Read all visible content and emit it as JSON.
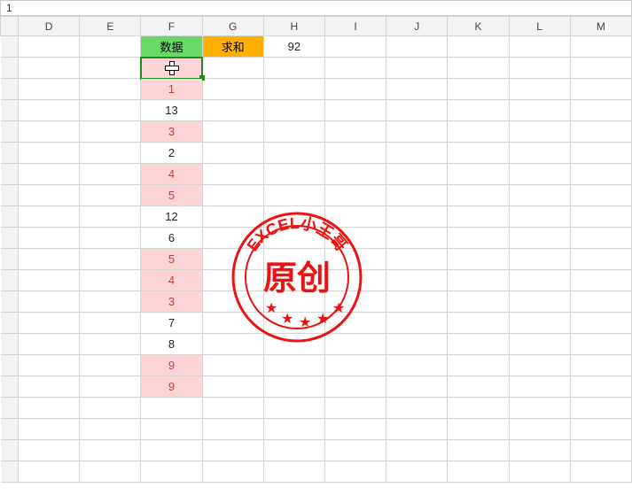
{
  "formula_bar": {
    "value": "1"
  },
  "columns": [
    "D",
    "E",
    "F",
    "G",
    "H",
    "I",
    "J",
    "K",
    "L",
    "M"
  ],
  "headers": {
    "F": {
      "label": "数据",
      "class": "hdr-f"
    },
    "G": {
      "label": "求和",
      "class": "hdr-g"
    },
    "H": {
      "label": "92",
      "class": "plain"
    }
  },
  "selected": {
    "col": "F",
    "row": 0
  },
  "chart_data": {
    "type": "table",
    "title": "数据",
    "sum_label": "求和",
    "sum_value": 92,
    "values": [
      1,
      1,
      13,
      3,
      2,
      4,
      5,
      12,
      6,
      5,
      4,
      3,
      7,
      8,
      9,
      9
    ],
    "highlighted": [
      true,
      true,
      false,
      true,
      false,
      true,
      true,
      false,
      false,
      true,
      true,
      true,
      false,
      false,
      true,
      true
    ]
  },
  "stamp": {
    "top_text": "EXCEL小王哥",
    "center_text": "原创"
  },
  "blank_rows_after": 4
}
